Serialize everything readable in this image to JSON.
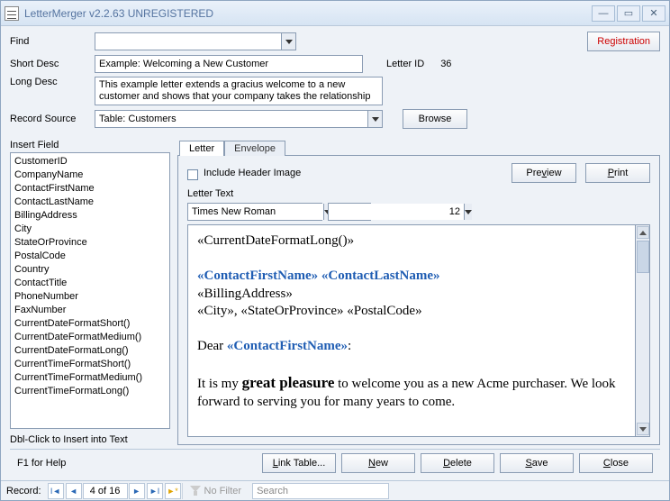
{
  "window": {
    "title": "LetterMerger v2.2.63 UNREGISTERED"
  },
  "top": {
    "find_label": "Find",
    "registration": "Registration",
    "shortdesc_label": "Short Desc",
    "shortdesc_value": "Example: Welcoming a New Customer",
    "letterid_label": "Letter ID",
    "letterid_value": "36",
    "longdesc_label": "Long Desc",
    "longdesc_value": "This example letter extends a gracius welcome to a new customer and shows that your company takes the relationship",
    "recordsource_label": "Record Source",
    "recordsource_value": "Table: Customers",
    "browse": "Browse"
  },
  "fields": {
    "header": "Insert Field",
    "items": [
      "CustomerID",
      "CompanyName",
      "ContactFirstName",
      "ContactLastName",
      "BillingAddress",
      "City",
      "StateOrProvince",
      "PostalCode",
      "Country",
      "ContactTitle",
      "PhoneNumber",
      "FaxNumber",
      "CurrentDateFormatShort()",
      "CurrentDateFormatMedium()",
      "CurrentDateFormatLong()",
      "CurrentTimeFormatShort()",
      "CurrentTimeFormatMedium()",
      "CurrentTimeFormatLong()"
    ],
    "hint": "Dbl-Click to Insert into Text"
  },
  "tabs": {
    "letter": "Letter",
    "envelope": "Envelope"
  },
  "letterpane": {
    "include_header": "Include Header Image",
    "preview": "Preview",
    "print": "Print",
    "lettertext_label": "Letter Text",
    "font": "Times New Roman",
    "size": "12"
  },
  "editor": {
    "l1": "«CurrentDateFormatLong()»",
    "l2a": "«ContactFirstName»",
    "l2b": "«ContactLastName»",
    "l3": "«BillingAddress»",
    "l4": "«City», «StateOrProvince» «PostalCode»",
    "l5a": "Dear ",
    "l5b": "«ContactFirstName»",
    "l5c": ":",
    "l6a": "It is my ",
    "l6b": "great pleasure",
    "l6c": " to welcome you as a new Acme purchaser.  We look forward to serving you for many years to come."
  },
  "buttons": {
    "link_table": "Link Table...",
    "new": "New",
    "delete": "Delete",
    "save": "Save",
    "close": "Close"
  },
  "status": {
    "help": "F1 for Help"
  },
  "recordbar": {
    "label": "Record:",
    "pos": "4 of 16",
    "nofilter": "No Filter",
    "search": "Search"
  }
}
